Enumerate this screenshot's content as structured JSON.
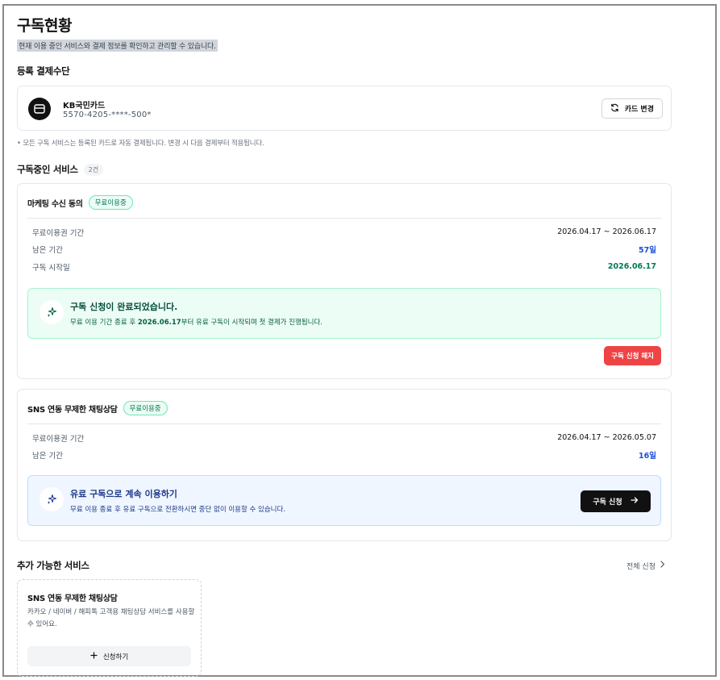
{
  "page": {
    "title": "구독현황",
    "description": "현재 이용 중인 서비스와 결제 정보를 확인하고 관리할 수 있습니다."
  },
  "payment": {
    "section_title": "등록 결제수단",
    "card_name": "KB국민카드",
    "card_number": "5570-4205-****-500*",
    "change_button": "카드 변경",
    "note": "• 모든 구독 서비스는 등록된 카드로 자동 결제됩니다. 변경 시 다음 결제부터 적용됩니다."
  },
  "subscriptions": {
    "section_title": "구독중인 서비스",
    "count": "2건",
    "items": [
      {
        "title": "마케팅 수신 동의",
        "badge": "무료이용중",
        "rows": [
          {
            "label": "무료이용권 기간",
            "value": "2026.04.17 ~ 2026.06.17"
          },
          {
            "label": "남은 기간",
            "value": "57일"
          },
          {
            "label": "구독 시작일",
            "value": "2026.06.17"
          }
        ],
        "banner_title": "구독 신청이 완료되었습니다.",
        "banner_text_prefix": "무료 이용 기간 종료 후 ",
        "banner_text_date": "2026.06.17",
        "banner_text_suffix": "부터 유료 구독이 시작되며 첫 결제가 진행됩니다.",
        "cancel_button": "구독 신청 해지"
      },
      {
        "title": "SNS 연동 무제한 채팅상담",
        "badge": "무료이용중",
        "rows": [
          {
            "label": "무료이용권 기간",
            "value": "2026.04.17 ~ 2026.05.07"
          },
          {
            "label": "남은 기간",
            "value": "16일"
          }
        ],
        "banner_title": "유료 구독으로 계속 이용하기",
        "banner_text": "무료 이용 종료 후 유료 구독으로 전환하시면 중단 없이 이용할 수 있습니다.",
        "subscribe_button": "구독 신청"
      }
    ]
  },
  "additional": {
    "section_title": "추가 가능한 서비스",
    "link_all": "전체 신청",
    "items": [
      {
        "title": "SNS 연동 무제한 채팅상담",
        "description": "카카오 / 네이버 / 해피톡 고객용 채팅상담 서비스를 사용할 수 있어요.",
        "apply_button": "신청하기"
      }
    ]
  },
  "colors": {
    "free_badge": "#047857",
    "cancel_button": "#ef4444",
    "success_banner": "#ecfdf5",
    "info_banner": "#eff6ff",
    "primary_dark": "#111111"
  },
  "icons": {
    "payment": "credit-card-icon",
    "change": "refresh-icon",
    "banner": "sparkle-icon",
    "arrow": "arrow-right-icon",
    "chevron": "chevron-right-icon",
    "plus": "plus-icon"
  }
}
